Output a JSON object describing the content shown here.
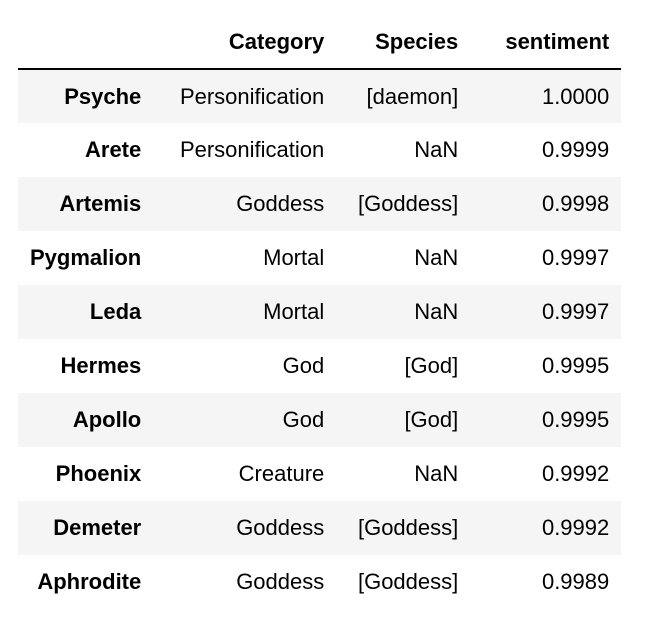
{
  "table": {
    "columns": [
      "",
      "Category",
      "Species",
      "sentiment"
    ],
    "rows": [
      {
        "index": "Psyche",
        "category": "Personification",
        "species": "[daemon]",
        "sentiment": "1.0000"
      },
      {
        "index": "Arete",
        "category": "Personification",
        "species": "NaN",
        "sentiment": "0.9999"
      },
      {
        "index": "Artemis",
        "category": "Goddess",
        "species": "[Goddess]",
        "sentiment": "0.9998"
      },
      {
        "index": "Pygmalion",
        "category": "Mortal",
        "species": "NaN",
        "sentiment": "0.9997"
      },
      {
        "index": "Leda",
        "category": "Mortal",
        "species": "NaN",
        "sentiment": "0.9997"
      },
      {
        "index": "Hermes",
        "category": "God",
        "species": "[God]",
        "sentiment": "0.9995"
      },
      {
        "index": "Apollo",
        "category": "God",
        "species": "[God]",
        "sentiment": "0.9995"
      },
      {
        "index": "Phoenix",
        "category": "Creature",
        "species": "NaN",
        "sentiment": "0.9992"
      },
      {
        "index": "Demeter",
        "category": "Goddess",
        "species": "[Goddess]",
        "sentiment": "0.9992"
      },
      {
        "index": "Aphrodite",
        "category": "Goddess",
        "species": "[Goddess]",
        "sentiment": "0.9989"
      }
    ]
  },
  "colors": {
    "stripe": "#f5f5f5",
    "background": "#ffffff",
    "text": "#000000"
  }
}
